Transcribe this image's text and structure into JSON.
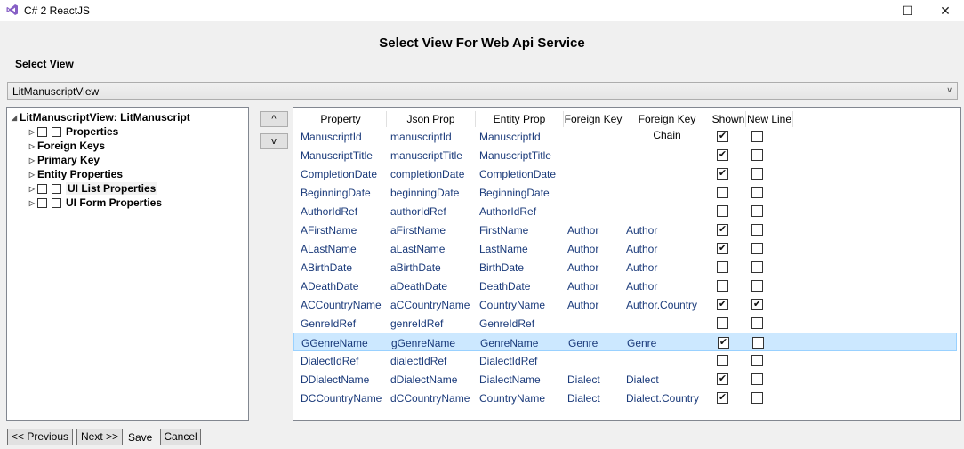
{
  "window": {
    "title": "C# 2 ReactJS",
    "minimize": "—",
    "maximize": "☐",
    "close": "✕"
  },
  "heading": "Select View For Web Api Service",
  "select_view": {
    "label": "Select View",
    "value": "LitManuscriptView"
  },
  "tree": {
    "root": "LitManuscriptView: LitManuscript",
    "items": [
      "Properties",
      "Foreign Keys",
      "Primary Key",
      "Entity Properties",
      "UI List Properties",
      "UI Form Properties"
    ]
  },
  "move": {
    "up": "^",
    "down": "v"
  },
  "grid": {
    "columns": [
      "Property",
      "Json Prop",
      "Entity Prop",
      "Foreign Key",
      "Foreign Key Chain",
      "Shown",
      "New Line"
    ],
    "rows": [
      [
        "ManuscriptId",
        "manuscriptId",
        "ManuscriptId",
        "",
        "",
        true,
        false
      ],
      [
        "ManuscriptTitle",
        "manuscriptTitle",
        "ManuscriptTitle",
        "",
        "",
        true,
        false
      ],
      [
        "CompletionDate",
        "completionDate",
        "CompletionDate",
        "",
        "",
        true,
        false
      ],
      [
        "BeginningDate",
        "beginningDate",
        "BeginningDate",
        "",
        "",
        false,
        false
      ],
      [
        "AuthorIdRef",
        "authorIdRef",
        "AuthorIdRef",
        "",
        "",
        false,
        false
      ],
      [
        "AFirstName",
        "aFirstName",
        "FirstName",
        "Author",
        "Author",
        true,
        false
      ],
      [
        "ALastName",
        "aLastName",
        "LastName",
        "Author",
        "Author",
        true,
        false
      ],
      [
        "ABirthDate",
        "aBirthDate",
        "BirthDate",
        "Author",
        "Author",
        false,
        false
      ],
      [
        "ADeathDate",
        "aDeathDate",
        "DeathDate",
        "Author",
        "Author",
        false,
        false
      ],
      [
        "ACCountryName",
        "aCCountryName",
        "CountryName",
        "Author",
        "Author.Country",
        true,
        true
      ],
      [
        "GenreIdRef",
        "genreIdRef",
        "GenreIdRef",
        "",
        "",
        false,
        false
      ],
      [
        "GGenreName",
        "gGenreName",
        "GenreName",
        "Genre",
        "Genre",
        true,
        false
      ],
      [
        "DialectIdRef",
        "dialectIdRef",
        "DialectIdRef",
        "",
        "",
        false,
        false
      ],
      [
        "DDialectName",
        "dDialectName",
        "DialectName",
        "Dialect",
        "Dialect",
        true,
        false
      ],
      [
        "DCCountryName",
        "dCCountryName",
        "CountryName",
        "Dialect",
        "Dialect.Country",
        true,
        false
      ]
    ],
    "selected_row": 11
  },
  "footer": {
    "previous": "<< Previous",
    "next": "Next >>",
    "save": "Save",
    "cancel": "Cancel"
  }
}
